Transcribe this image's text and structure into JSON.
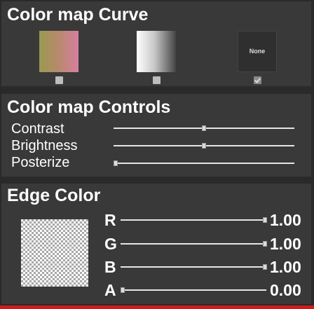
{
  "curve_panel": {
    "title": "Color map Curve",
    "swatches": [
      {
        "type": "gradient",
        "colors": [
          "#9a9a50",
          "#b58a6a",
          "#d77fa0"
        ],
        "checked": false
      },
      {
        "type": "gradient",
        "colors": [
          "#ffffff",
          "#c8c8c8",
          "#444444"
        ],
        "checked": false
      },
      {
        "type": "none",
        "label": "None",
        "checked": true
      }
    ]
  },
  "controls_panel": {
    "title": "Color map Controls",
    "sliders": [
      {
        "label": "Contrast",
        "value": 0.5
      },
      {
        "label": "Brightness",
        "value": 0.5
      },
      {
        "label": "Posterize",
        "value": 0.0
      }
    ]
  },
  "edge_panel": {
    "title": "Edge Color",
    "channels": [
      {
        "label": "R",
        "value": "1.00"
      },
      {
        "label": "G",
        "value": "1.00"
      },
      {
        "label": "B",
        "value": "1.00"
      },
      {
        "label": "A",
        "value": "0.00"
      }
    ]
  },
  "colors": {
    "panel_bg": "#393939",
    "page_bg": "#2a2a2a",
    "accent_bar": "#d11a1a"
  }
}
